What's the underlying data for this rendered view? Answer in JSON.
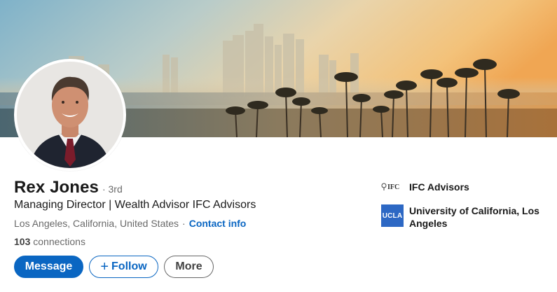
{
  "profile": {
    "name": "Rex Jones",
    "degree": "· 3rd",
    "headline": "Managing Director | Wealth Advisor IFC Advisors",
    "location": "Los Angeles, California, United States",
    "separator": "·",
    "contact_info_label": "Contact info",
    "connections_count": "103",
    "connections_label": "connections"
  },
  "actions": {
    "message_label": "Message",
    "follow_icon": "plus-icon",
    "follow_label": "Follow",
    "more_label": "More"
  },
  "organizations": [
    {
      "logo_text": "IFC",
      "logo_icon": "ifc-logo",
      "name": "IFC Advisors"
    },
    {
      "logo_text": "UCLA",
      "logo_icon": "ucla-logo",
      "name": "University of California, Los Angeles"
    }
  ],
  "colors": {
    "accent": "#0a66c2",
    "ucla_blue": "#2d68c4"
  }
}
